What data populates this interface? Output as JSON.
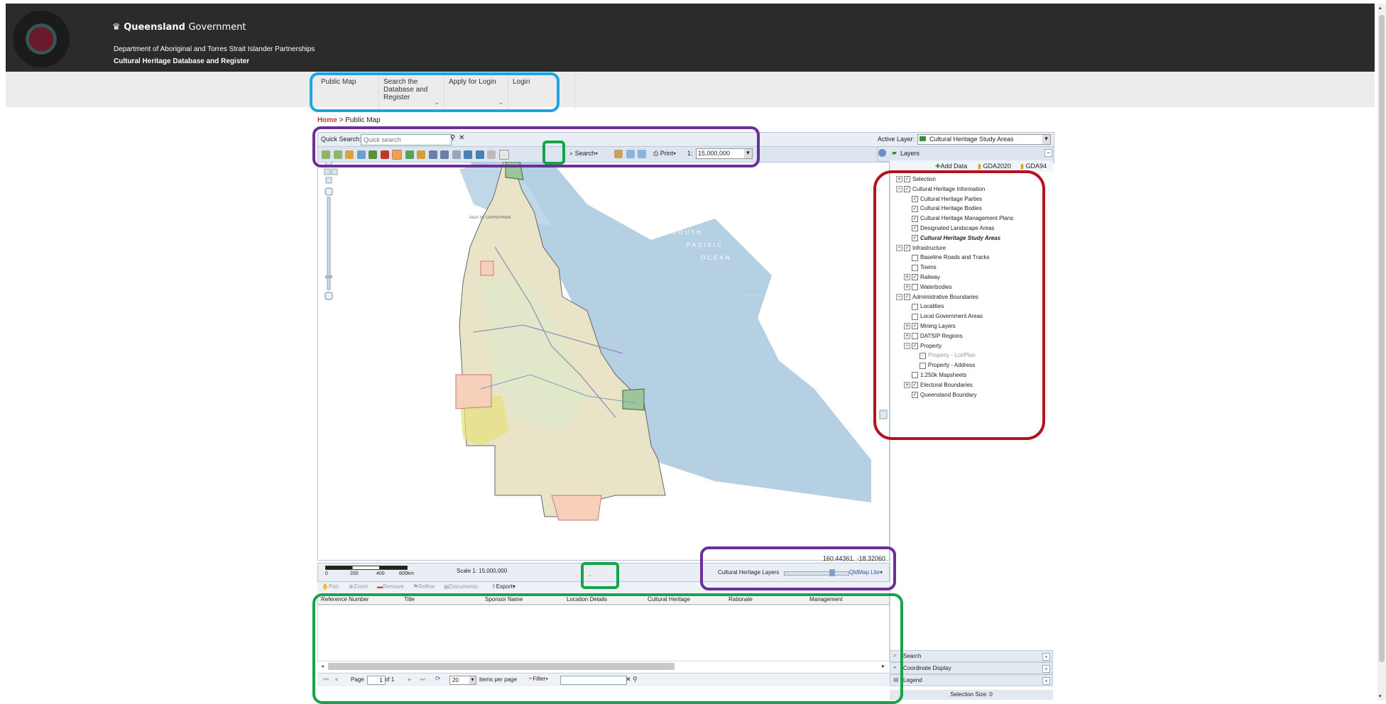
{
  "header": {
    "brand_bold": "Queensland",
    "brand_light": "Government",
    "department": "Department of Aboriginal and Torres Strait Islander Partnerships",
    "site_title": "Cultural Heritage Database and Register"
  },
  "nav": {
    "items": [
      {
        "label": "Public Map"
      },
      {
        "label": "Search the Database and Register"
      },
      {
        "label": "Apply for Login"
      },
      {
        "label": "Login"
      }
    ]
  },
  "breadcrumb": {
    "home": "Home",
    "separator": " > ",
    "current": "Public Map"
  },
  "quick_search": {
    "label": "Quick Search:",
    "placeholder": "Quick search"
  },
  "active_layer": {
    "label": "Active Layer:",
    "value": "Cultural Heritage Study Areas"
  },
  "toolbar": {
    "search_label": "Search",
    "print_label": "Print",
    "scale_prefix": "1:",
    "scale_value": "15,000,000"
  },
  "map": {
    "labels": {
      "sea1": "CORAL SEA",
      "gulf": "GULF OF CARPENTARIA",
      "ocean1": "SOUTH",
      "ocean2": "PACIFIC",
      "ocean3": "OCEAN",
      "coral": "CORAL SEA"
    },
    "coordinates": "160.44361, -18.32060",
    "scale_text": "Scale 1: 15,000,000",
    "scalebar_ticks": [
      "0",
      "200",
      "400",
      "600km"
    ],
    "opacity_label": "Cultural Heritage Layers",
    "basemap": "QldMap Lite"
  },
  "layers_panel": {
    "title": "Layers",
    "tabs": [
      "Add Data",
      "GDA2020",
      "GDA94"
    ],
    "tree": [
      {
        "label": "Selection",
        "checked": true
      },
      {
        "label": "Cultural Heritage Information",
        "checked": true
      },
      {
        "label": "Cultural Heritage Parties",
        "checked": true
      },
      {
        "label": "Cultural Heritage Bodies",
        "checked": true
      },
      {
        "label": "Cultural Heritage Management Plans",
        "checked": true
      },
      {
        "label": "Designated Landscape Areas",
        "checked": true
      },
      {
        "label": "Cultural Heritage Study Areas",
        "checked": true
      },
      {
        "label": "Infrastructure",
        "checked": true
      },
      {
        "label": "Baseline Roads and Tracks",
        "checked": false
      },
      {
        "label": "Towns",
        "checked": false
      },
      {
        "label": "Railway",
        "checked": true
      },
      {
        "label": "Waterbodies",
        "checked": false
      },
      {
        "label": "Administrative Boundaries",
        "checked": true
      },
      {
        "label": "Localities",
        "checked": false
      },
      {
        "label": "Local Government Areas",
        "checked": false
      },
      {
        "label": "Mining Layers",
        "checked": true
      },
      {
        "label": "DATSIP Regions",
        "checked": false
      },
      {
        "label": "Property",
        "checked": true
      },
      {
        "label": "Property - Lot/Plan",
        "checked": true
      },
      {
        "label": "Property - Address",
        "checked": false
      },
      {
        "label": "1:250k Mapsheets",
        "checked": false
      },
      {
        "label": "Electoral Boundaries",
        "checked": true
      },
      {
        "label": "Queensland Boundary",
        "checked": true
      }
    ],
    "accordions": [
      "Search",
      "Coordinate Display",
      "Legend"
    ],
    "selection_size": "Selection Size: 0"
  },
  "results": {
    "actions": [
      "Pan",
      "Zoom",
      "Remove",
      "Refine",
      "Documents",
      "Export"
    ],
    "columns": [
      "Reference Number",
      "Title",
      "Sponsor Name",
      "Location Details",
      "Cultural Heritage",
      "Rationale",
      "Management"
    ],
    "pager": {
      "page_label": "Page",
      "page_value": "1",
      "of_label": "of 1",
      "per_page_value": "20",
      "per_page_label": "items per page",
      "filter_label": "Filter"
    }
  },
  "colors": {
    "header_bg": "#2b2b2b",
    "brand_red": "#c0392b",
    "annotation_blue": "#1fa4e0",
    "annotation_purple": "#6a2f9a",
    "annotation_green": "#16a34a",
    "annotation_red": "#b3121f"
  }
}
